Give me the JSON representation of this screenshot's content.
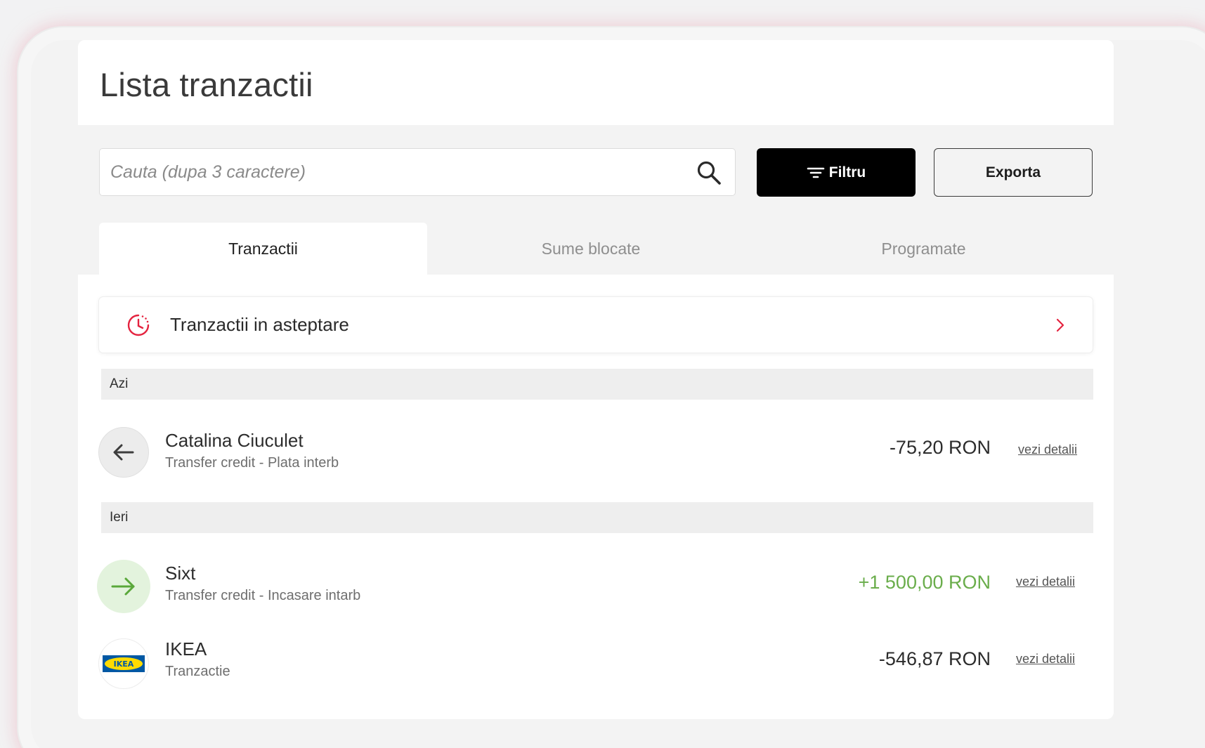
{
  "page": {
    "title": "Lista tranzactii"
  },
  "toolbar": {
    "search_placeholder": "Cauta (dupa 3 caractere)",
    "filter_label": "Filtru",
    "export_label": "Exporta"
  },
  "tabs": [
    {
      "label": "Tranzactii",
      "active": true
    },
    {
      "label": "Sume blocate",
      "active": false
    },
    {
      "label": "Programate",
      "active": false
    }
  ],
  "pending": {
    "label": "Tranzactii in asteptare",
    "icon": "clock-icon"
  },
  "groups": [
    {
      "label": "Azi",
      "transactions": [
        {
          "name": "Catalina Ciuculet",
          "description": "Transfer credit - Plata interb",
          "amount": "-75,20 RON",
          "direction": "out",
          "details_label": "vezi detalii",
          "icon": "arrow-left-icon"
        }
      ]
    },
    {
      "label": "Ieri",
      "transactions": [
        {
          "name": "Sixt",
          "description": "Transfer credit - Incasare intarb",
          "amount": "+1 500,00 RON",
          "direction": "in",
          "details_label": "vezi detalii",
          "icon": "arrow-right-icon"
        },
        {
          "name": "IKEA",
          "description": "Tranzactie",
          "amount": "-546,87 RON",
          "direction": "out",
          "details_label": "vezi detalii",
          "icon": "ikea-logo",
          "logo_text": "IKEA"
        }
      ]
    }
  ],
  "colors": {
    "accent": "#e4233f",
    "positive": "#6aad4b",
    "ikea_blue": "#0058a3",
    "ikea_yellow": "#ffdb00"
  }
}
